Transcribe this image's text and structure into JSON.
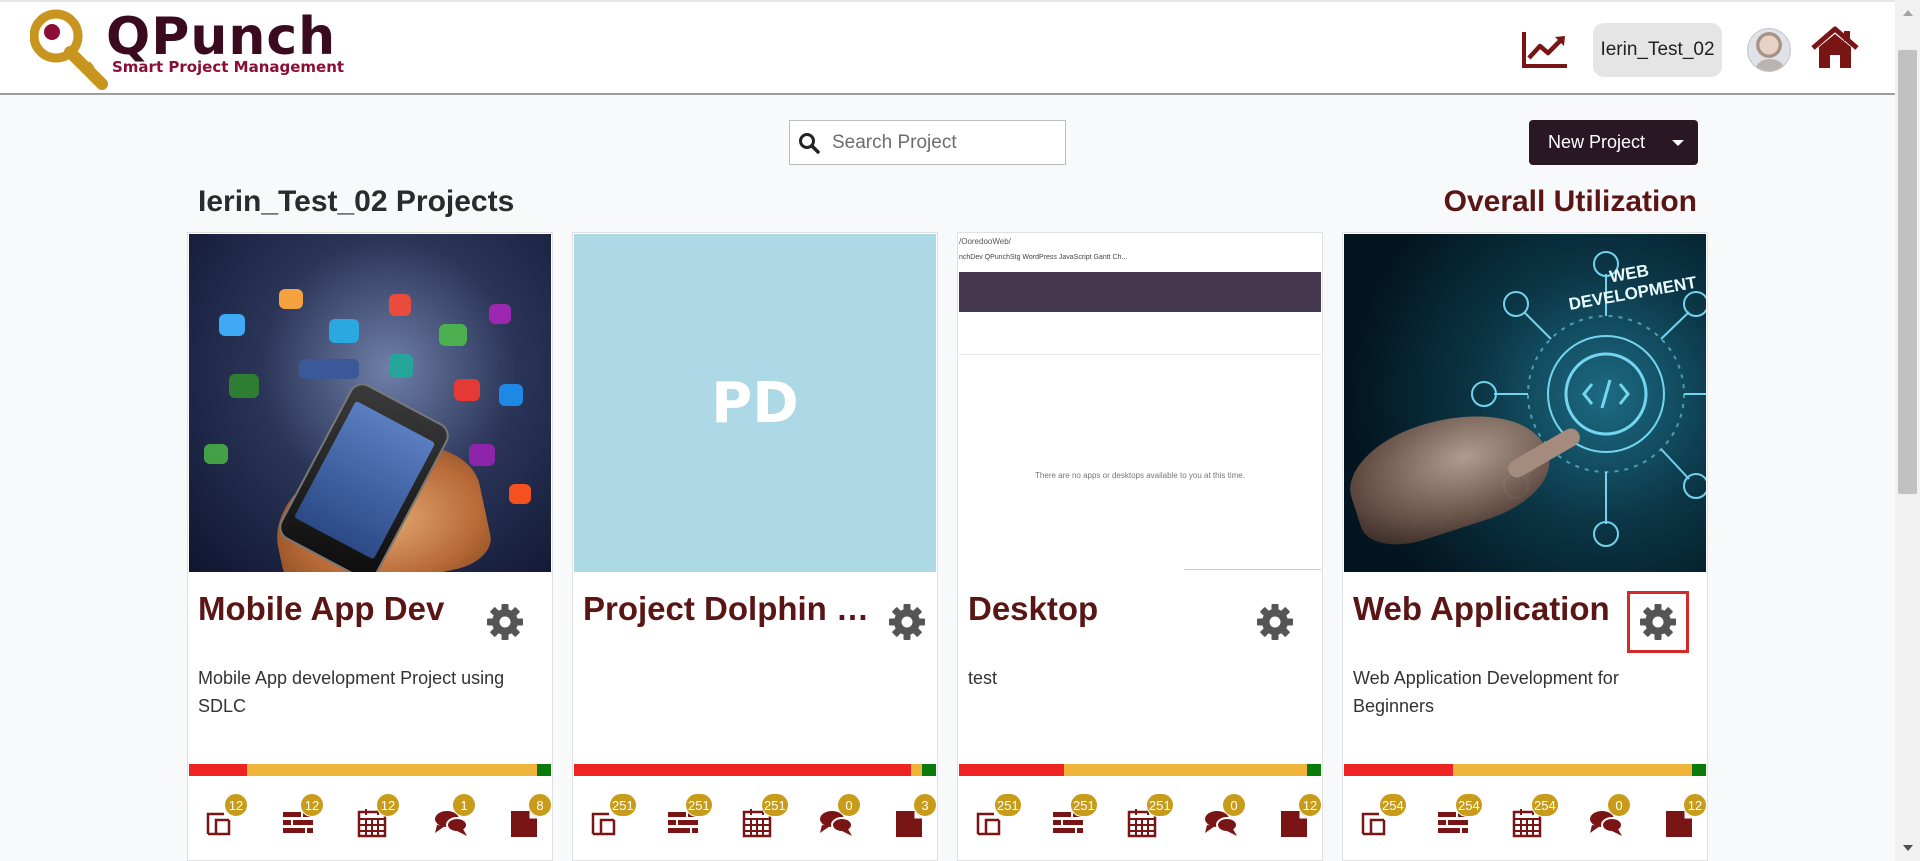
{
  "app": {
    "logo_text": "QPunch",
    "logo_tagline": "Smart Project Management",
    "user_name": "Ierin_Test_02"
  },
  "toolbar": {
    "search_placeholder": "Search Project",
    "new_project_label": "New Project"
  },
  "section": {
    "title": "Ierin_Test_02 Projects",
    "overall_label": "Overall Utilization"
  },
  "colors": {
    "brand_dark": "#2a1724",
    "title_red": "#5a1515",
    "badge_gold": "#c89b1b",
    "util_red": "#ee2424",
    "util_amber": "#f0b43a",
    "util_green": "#0a7a0a"
  },
  "projects": [
    {
      "title": "Mobile App Dev",
      "description": "Mobile App development Project using SDLC",
      "image": "mobile-apps-photo",
      "utilization": {
        "red": 0.16,
        "amber": 0.8,
        "green": 0.04
      },
      "counts": {
        "modules": "12",
        "tasks": "12",
        "schedule": "12",
        "comments": "1",
        "documents": "8"
      }
    },
    {
      "title": "Project Dolphin Fit...",
      "description": "",
      "image_text": "PD",
      "utilization": {
        "red": 0.93,
        "amber": 0.03,
        "green": 0.04
      },
      "counts": {
        "modules": "251",
        "tasks": "251",
        "schedule": "251",
        "comments": "0",
        "documents": "3"
      }
    },
    {
      "title": "Desktop",
      "description": "test",
      "image": "desktop-screenshot",
      "screenshot": {
        "url": "/OoredooWeb/",
        "bookmarks": "nchDev  QPunchStg  WordPress  JavaScript Gantt Ch...",
        "message": "There are no apps or desktops available to you at this time."
      },
      "utilization": {
        "red": 0.29,
        "amber": 0.67,
        "green": 0.04
      },
      "counts": {
        "modules": "251",
        "tasks": "251",
        "schedule": "251",
        "comments": "0",
        "documents": "12"
      }
    },
    {
      "title": "Web Application",
      "description": "Web Application Development for Beginners",
      "image": "web-development-photo",
      "image_text": "WEB DEVELOPMENT",
      "utilization": {
        "red": 0.3,
        "amber": 0.66,
        "green": 0.04
      },
      "counts": {
        "modules": "254",
        "tasks": "254",
        "schedule": "254",
        "comments": "0",
        "documents": "12"
      }
    }
  ]
}
